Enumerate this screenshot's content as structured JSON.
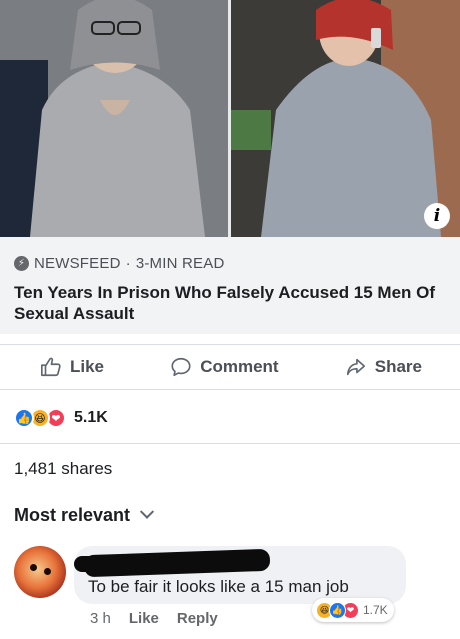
{
  "post": {
    "images": [
      "photo-left",
      "photo-right"
    ],
    "info_icon": "i"
  },
  "preview": {
    "source": "NEWSFEED",
    "separator": "·",
    "read_time": "3-MIN READ",
    "headline": "Ten Years In Prison Who Falsely Accused 15 Men Of Sexual Assault"
  },
  "actions": {
    "like": "Like",
    "comment": "Comment",
    "share": "Share"
  },
  "reactions": {
    "types": [
      "like",
      "haha",
      "love"
    ],
    "count": "5.1K"
  },
  "shares": "1,481 shares",
  "sort": {
    "label": "Most relevant"
  },
  "comment": {
    "text": "To be fair it looks like a 15 man job",
    "time": "3 h",
    "like": "Like",
    "reply": "Reply",
    "reaction_types": [
      "haha",
      "like",
      "love"
    ],
    "reaction_count": "1.7K"
  },
  "colors": {
    "like_blue": "#1877f2",
    "love_red": "#f33e58",
    "haha_yellow": "#f7b125",
    "text_secondary": "#65676b"
  }
}
